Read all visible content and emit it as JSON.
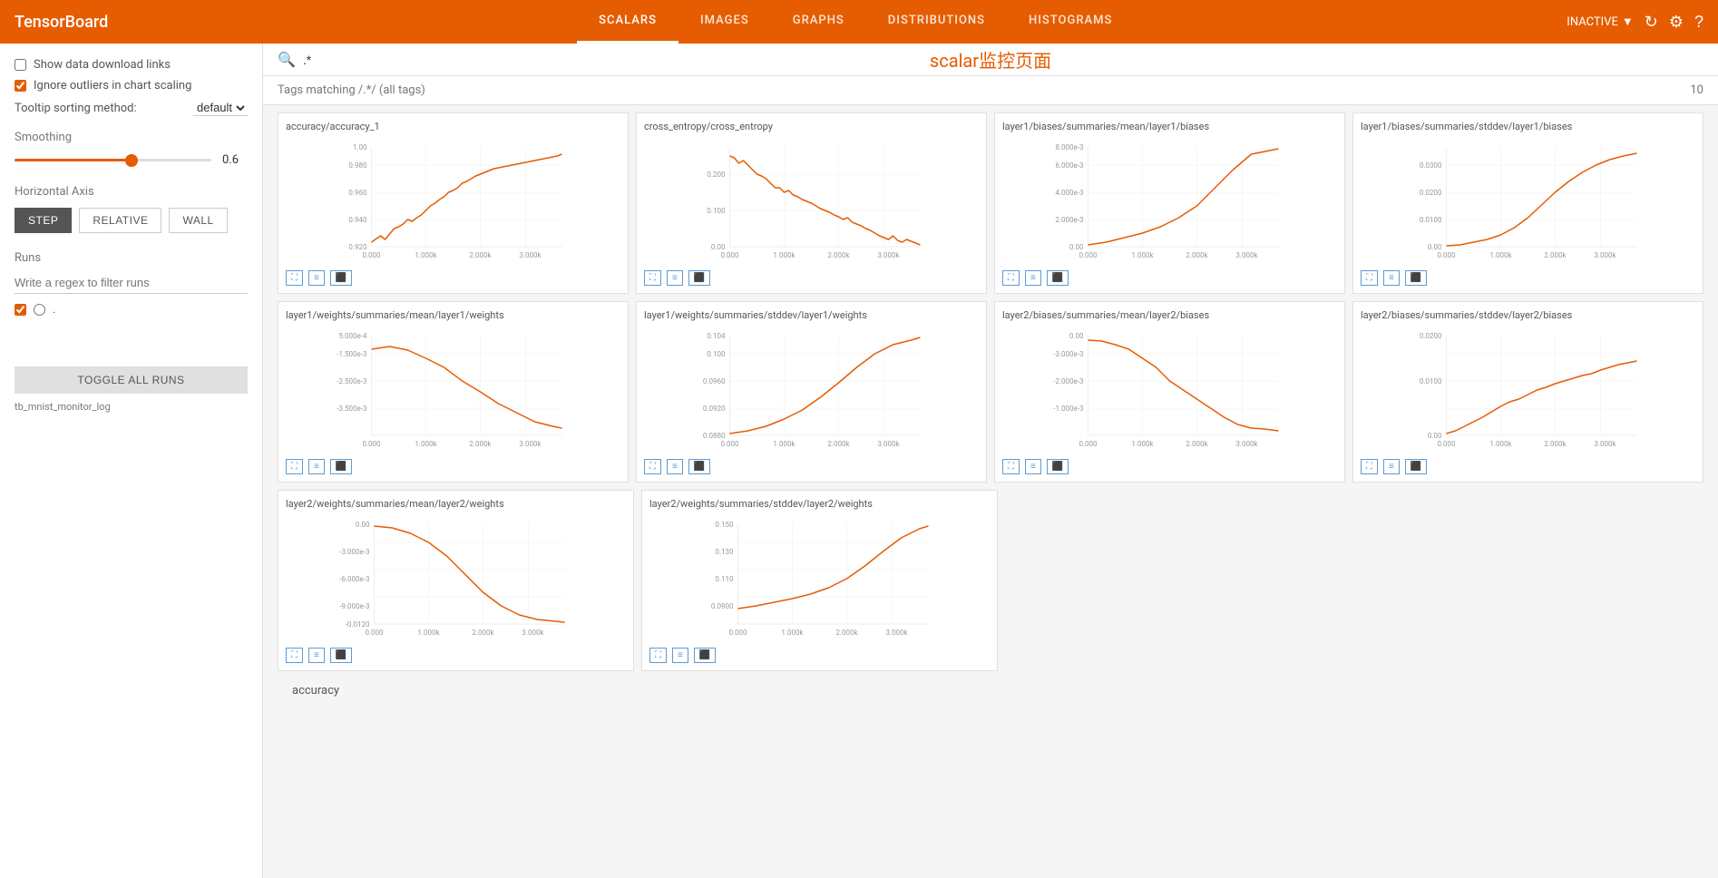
{
  "header": {
    "logo": "TensorBoard",
    "nav_items": [
      {
        "id": "scalars",
        "label": "SCALARS",
        "active": true
      },
      {
        "id": "images",
        "label": "IMAGES",
        "active": false
      },
      {
        "id": "graphs",
        "label": "GRAPHS",
        "active": false
      },
      {
        "id": "distributions",
        "label": "DISTRIBUTIONS",
        "active": false
      },
      {
        "id": "histograms",
        "label": "HISTOGRAMS",
        "active": false
      }
    ],
    "dropdown_label": "INACTIVE",
    "refresh_icon": "↻",
    "settings_icon": "⚙",
    "help_icon": "?"
  },
  "sidebar": {
    "show_download_links_label": "Show data download links",
    "ignore_outliers_label": "Ignore outliers in chart scaling",
    "tooltip_sort_label": "Tooltip sorting method:",
    "tooltip_sort_value": "default",
    "smoothing_label": "Smoothing",
    "smoothing_value": "0.6",
    "horizontal_axis_label": "Horizontal Axis",
    "axis_options": [
      "STEP",
      "RELATIVE",
      "WALL"
    ],
    "axis_active": "STEP",
    "runs_label": "Runs",
    "run_filter_placeholder": "Write a regex to filter runs",
    "run_items": [
      {
        "name": ".",
        "checked": true
      }
    ],
    "toggle_all_label": "TOGGLE ALL RUNS",
    "footer_path": "tb_mnist_monitor_log"
  },
  "search": {
    "placeholder": ".*",
    "value": ".*",
    "page_title": "scalar监控页面"
  },
  "tags_row": {
    "text": "Tags matching /.*/  (all tags)",
    "count": "10"
  },
  "charts": [
    {
      "row": 0,
      "items": [
        {
          "id": "accuracy_1",
          "title": "accuracy/accuracy_1",
          "ymin": 0.92,
          "ymax": 1.0,
          "type": "rise_noisy"
        },
        {
          "id": "cross_entropy",
          "title": "cross_entropy/cross_entropy",
          "ymin": 0.0,
          "ymax": 0.2,
          "type": "fall_noisy"
        },
        {
          "id": "layer1_biases_mean",
          "title": "layer1/biases/summaries/mean/layer1/biases",
          "ymin": 0.0,
          "ymax": 0.008,
          "type": "rise_smooth"
        },
        {
          "id": "layer1_biases_stddev",
          "title": "layer1/biases/summaries/stddev/layer1/biases",
          "ymin": 0.0,
          "ymax": 0.03,
          "type": "rise_curve"
        }
      ]
    },
    {
      "row": 1,
      "items": [
        {
          "id": "layer1_weights_mean",
          "title": "layer1/weights/summaries/mean/layer1/weights",
          "ymin": -0.0035,
          "ymax": 0.0005,
          "type": "fall_smooth"
        },
        {
          "id": "layer1_weights_stddev",
          "title": "layer1/weights/summaries/stddev/layer1/weights",
          "ymin": 0.088,
          "ymax": 0.104,
          "type": "rise_curve"
        },
        {
          "id": "layer2_biases_mean",
          "title": "layer2/biases/summaries/mean/layer2/biases",
          "ymin": -0.003,
          "ymax": 0.0,
          "type": "fall_smooth2"
        },
        {
          "id": "layer2_biases_stddev",
          "title": "layer2/biases/summaries/stddev/layer2/biases",
          "ymin": 0.0,
          "ymax": 0.02,
          "type": "rise_noisy2"
        }
      ]
    },
    {
      "row": 2,
      "items": [
        {
          "id": "layer2_weights_mean",
          "title": "layer2/weights/summaries/mean/layer2/weights",
          "ymin": -0.012,
          "ymax": 0.0,
          "type": "fall_deep"
        },
        {
          "id": "layer2_weights_stddev",
          "title": "layer2/weights/summaries/stddev/layer2/weights",
          "ymin": 0.09,
          "ymax": 0.15,
          "type": "rise_curve2"
        }
      ]
    }
  ],
  "section_label": "accuracy",
  "chart_controls": {
    "expand_icon": "⛶",
    "list_icon": "≡",
    "download_icon": "⬛"
  },
  "colors": {
    "orange": "#e65c00",
    "blue": "#5b9bd5",
    "line": "#e65c00"
  }
}
